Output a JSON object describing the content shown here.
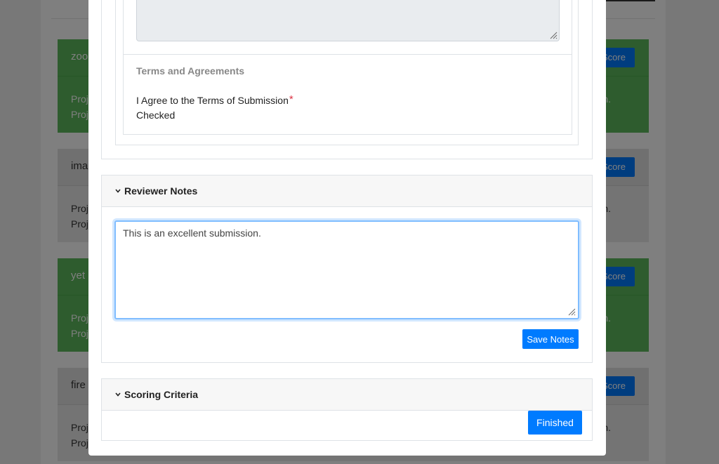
{
  "background": {
    "score_label": "Score",
    "cards": [
      {
        "title": "zoo",
        "line1": "Proj",
        "line2": "Proj",
        "tail": "n.",
        "color": "green"
      },
      {
        "title": "ima",
        "line1": "Proj",
        "line2": "Proj",
        "tail": "n.",
        "color": "grey"
      },
      {
        "title": "yet",
        "line1": "Proj",
        "line2": "Proj",
        "tail": "n.",
        "color": "green"
      },
      {
        "title": "fire",
        "line1": "Proj",
        "line2": "Proj",
        "tail": "n.",
        "color": "grey"
      }
    ]
  },
  "modal": {
    "terms": {
      "heading": "Terms and Agreements",
      "label": "I Agree to the Terms of Submission",
      "required_mark": "*",
      "value": "Checked"
    },
    "reviewer_notes": {
      "title": "Reviewer Notes",
      "notes_text": "This is an excellent submission.",
      "save_label": "Save Notes"
    },
    "scoring": {
      "title": "Scoring Criteria",
      "finished_label": "Finished"
    }
  },
  "colors": {
    "primary": "#007bff",
    "success": "#5cb85c",
    "required": "#dc3545",
    "focus_border": "#80bdff"
  }
}
